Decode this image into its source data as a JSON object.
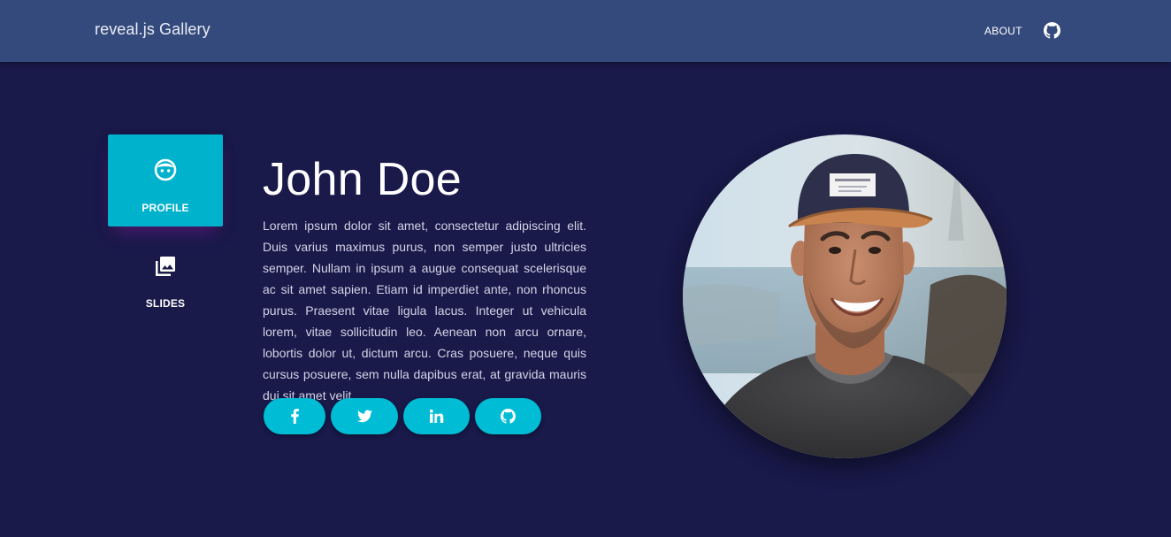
{
  "navbar": {
    "brand": "reveal.js Gallery",
    "about_label": "ABOUT",
    "github_icon": "github-icon",
    "background": "#354a7c"
  },
  "sidebar": {
    "tabs": [
      {
        "label": "PROFILE",
        "icon": "face-icon",
        "active": true
      },
      {
        "label": "SLIDES",
        "icon": "photo-library-icon",
        "active": false
      }
    ],
    "active_color": "#00b2cc"
  },
  "profile": {
    "name": "John Doe",
    "bio": "Lorem ipsum dolor sit amet, consectetur adipiscing elit. Duis varius maximus purus, non semper justo ultricies semper. Nullam in ipsum a augue consequat scelerisque ac sit amet sapien. Etiam id imperdiet ante, non rhoncus purus. Praesent vitae ligula lacus. Integer ut vehicula lorem, vitae sollicitudin leo. Aenean non arcu ornare, lobortis dolor ut, dictum arcu. Cras posuere, neque quis cursus posuere, sem nulla dapibus erat, at gravida mauris dui sit amet velit.",
    "social_buttons": [
      {
        "icon": "facebook-icon"
      },
      {
        "icon": "twitter-icon"
      },
      {
        "icon": "linkedin-icon"
      },
      {
        "icon": "github-icon"
      }
    ],
    "button_color": "#00bcd4"
  },
  "theme": {
    "background": "#19194a"
  }
}
